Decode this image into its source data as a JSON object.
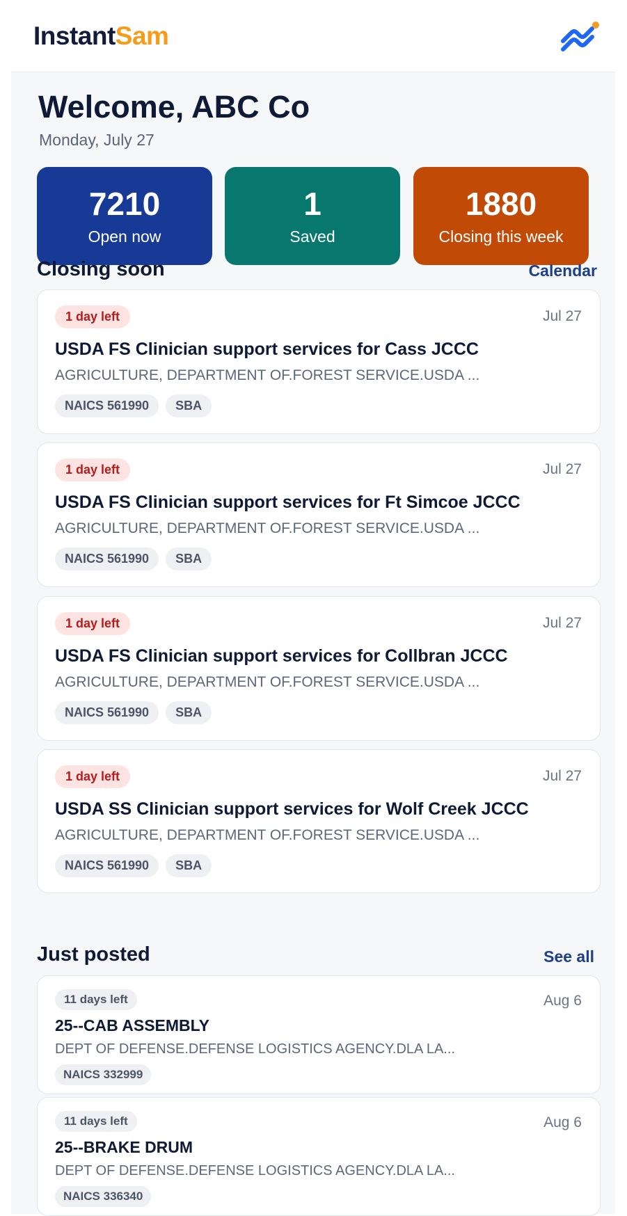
{
  "header": {
    "logo_part1": "Instant",
    "logo_part2": "Sam",
    "brand_icon": "wave-icon",
    "accent_colors": [
      "#1e66f5",
      "#f59c1a"
    ]
  },
  "welcome": {
    "title": "Welcome, ABC Co",
    "date": "Monday, July 27"
  },
  "stats": [
    {
      "value": "7210",
      "label": "Open now",
      "color": "#163a96"
    },
    {
      "value": "1",
      "label": "Saved",
      "color": "#08786e"
    },
    {
      "value": "1880",
      "label": "Closing this week",
      "color": "#c14a06"
    }
  ],
  "closing_soon": {
    "title": "Closing soon",
    "link": "Calendar",
    "items": [
      {
        "badge": "1 day left",
        "date": "Jul 27",
        "title": "USDA FS Clinician support services for Cass JCCC",
        "agency": "AGRICULTURE, DEPARTMENT OF.FOREST SERVICE.USDA ...",
        "tags": [
          "NAICS 561990",
          "SBA"
        ]
      },
      {
        "badge": "1 day left",
        "date": "Jul 27",
        "title": "USDA FS Clinician support services for Ft Simcoe JCCC",
        "agency": "AGRICULTURE, DEPARTMENT OF.FOREST SERVICE.USDA ...",
        "tags": [
          "NAICS 561990",
          "SBA"
        ]
      },
      {
        "badge": "1 day left",
        "date": "Jul 27",
        "title": "USDA FS Clinician support services for Collbran JCCC",
        "agency": "AGRICULTURE, DEPARTMENT OF.FOREST SERVICE.USDA ...",
        "tags": [
          "NAICS 561990",
          "SBA"
        ]
      },
      {
        "badge": "1 day left",
        "date": "Jul 27",
        "title": "USDA SS Clinician support services for Wolf Creek JCCC",
        "agency": "AGRICULTURE, DEPARTMENT OF.FOREST SERVICE.USDA ...",
        "tags": [
          "NAICS 561990",
          "SBA"
        ]
      }
    ]
  },
  "just_posted": {
    "title": "Just posted",
    "link": "See all",
    "items": [
      {
        "badge": "11 days left",
        "date": "Aug 6",
        "title": "25--CAB ASSEMBLY",
        "agency": "DEPT OF DEFENSE.DEFENSE LOGISTICS AGENCY.DLA LA...",
        "tags": [
          "NAICS 332999"
        ]
      },
      {
        "badge": "11 days left",
        "date": "Aug 6",
        "title": "25--BRAKE DRUM",
        "agency": "DEPT OF DEFENSE.DEFENSE LOGISTICS AGENCY.DLA LA...",
        "tags": [
          "NAICS 336340"
        ]
      }
    ]
  }
}
